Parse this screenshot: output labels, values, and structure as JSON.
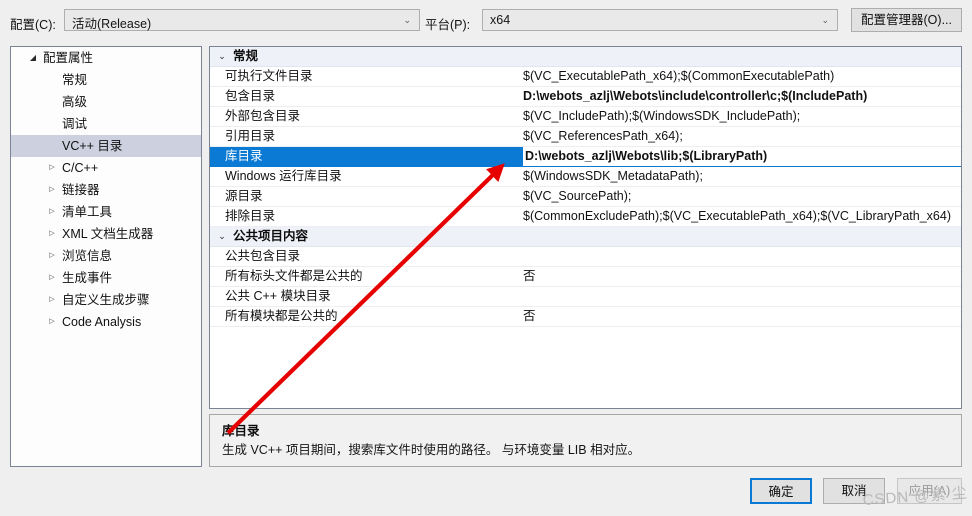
{
  "topbar": {
    "config_label": "配置(C):",
    "config_value": "活动(Release)",
    "platform_label": "平台(P):",
    "platform_value": "x64",
    "config_manager_button": "配置管理器(O)...",
    "chevron": "⌄"
  },
  "tree": {
    "expander_open": "◢",
    "expander_closed": "▷",
    "items": [
      {
        "label": "配置属性",
        "level": 0,
        "expander": "open",
        "selected": false
      },
      {
        "label": "常规",
        "level": 1,
        "expander": "none",
        "selected": false
      },
      {
        "label": "高级",
        "level": 1,
        "expander": "none",
        "selected": false
      },
      {
        "label": "调试",
        "level": 1,
        "expander": "none",
        "selected": false
      },
      {
        "label": "VC++ 目录",
        "level": 1,
        "expander": "none",
        "selected": true
      },
      {
        "label": "C/C++",
        "level": 1,
        "expander": "closed",
        "selected": false
      },
      {
        "label": "链接器",
        "level": 1,
        "expander": "closed",
        "selected": false
      },
      {
        "label": "清单工具",
        "level": 1,
        "expander": "closed",
        "selected": false
      },
      {
        "label": "XML 文档生成器",
        "level": 1,
        "expander": "closed",
        "selected": false
      },
      {
        "label": "浏览信息",
        "level": 1,
        "expander": "closed",
        "selected": false
      },
      {
        "label": "生成事件",
        "level": 1,
        "expander": "closed",
        "selected": false
      },
      {
        "label": "自定义生成步骤",
        "level": 1,
        "expander": "closed",
        "selected": false
      },
      {
        "label": "Code Analysis",
        "level": 1,
        "expander": "closed",
        "selected": false
      }
    ]
  },
  "grid": {
    "section_chevron": "⌄",
    "dropdown_chevron": "⌄",
    "sections": [
      {
        "title": "常规",
        "rows": [
          {
            "name": "可执行文件目录",
            "value": "$(VC_ExecutablePath_x64);$(CommonExecutablePath)",
            "bold": false,
            "selected": false
          },
          {
            "name": "包含目录",
            "value": "D:\\webots_azlj\\Webots\\include\\controller\\c;$(IncludePath)",
            "bold": true,
            "selected": false
          },
          {
            "name": "外部包含目录",
            "value": "$(VC_IncludePath);$(WindowsSDK_IncludePath);",
            "bold": false,
            "selected": false
          },
          {
            "name": "引用目录",
            "value": "$(VC_ReferencesPath_x64);",
            "bold": false,
            "selected": false
          },
          {
            "name": "库目录",
            "value": "D:\\webots_azlj\\Webots\\lib;$(LibraryPath)",
            "bold": true,
            "selected": true
          },
          {
            "name": "Windows 运行库目录",
            "value": "$(WindowsSDK_MetadataPath);",
            "bold": false,
            "selected": false
          },
          {
            "name": "源目录",
            "value": "$(VC_SourcePath);",
            "bold": false,
            "selected": false
          },
          {
            "name": "排除目录",
            "value": "$(CommonExcludePath);$(VC_ExecutablePath_x64);$(VC_LibraryPath_x64)",
            "bold": false,
            "selected": false
          }
        ]
      },
      {
        "title": "公共项目内容",
        "rows": [
          {
            "name": "公共包含目录",
            "value": "",
            "bold": false,
            "selected": false
          },
          {
            "name": "所有标头文件都是公共的",
            "value": "否",
            "bold": false,
            "selected": false
          },
          {
            "name": "公共 C++ 模块目录",
            "value": "",
            "bold": false,
            "selected": false
          },
          {
            "name": "所有模块都是公共的",
            "value": "否",
            "bold": false,
            "selected": false
          }
        ]
      }
    ]
  },
  "description": {
    "title": "库目录",
    "text": "生成 VC++ 项目期间，搜索库文件时使用的路径。  与环境变量 LIB 相对应。"
  },
  "buttons": {
    "ok": "确定",
    "cancel": "取消",
    "apply": "应用(A)"
  },
  "watermark": {
    "text": "CSDN @紫 尘"
  },
  "annotation": {
    "arrow_color": "#e60000"
  }
}
